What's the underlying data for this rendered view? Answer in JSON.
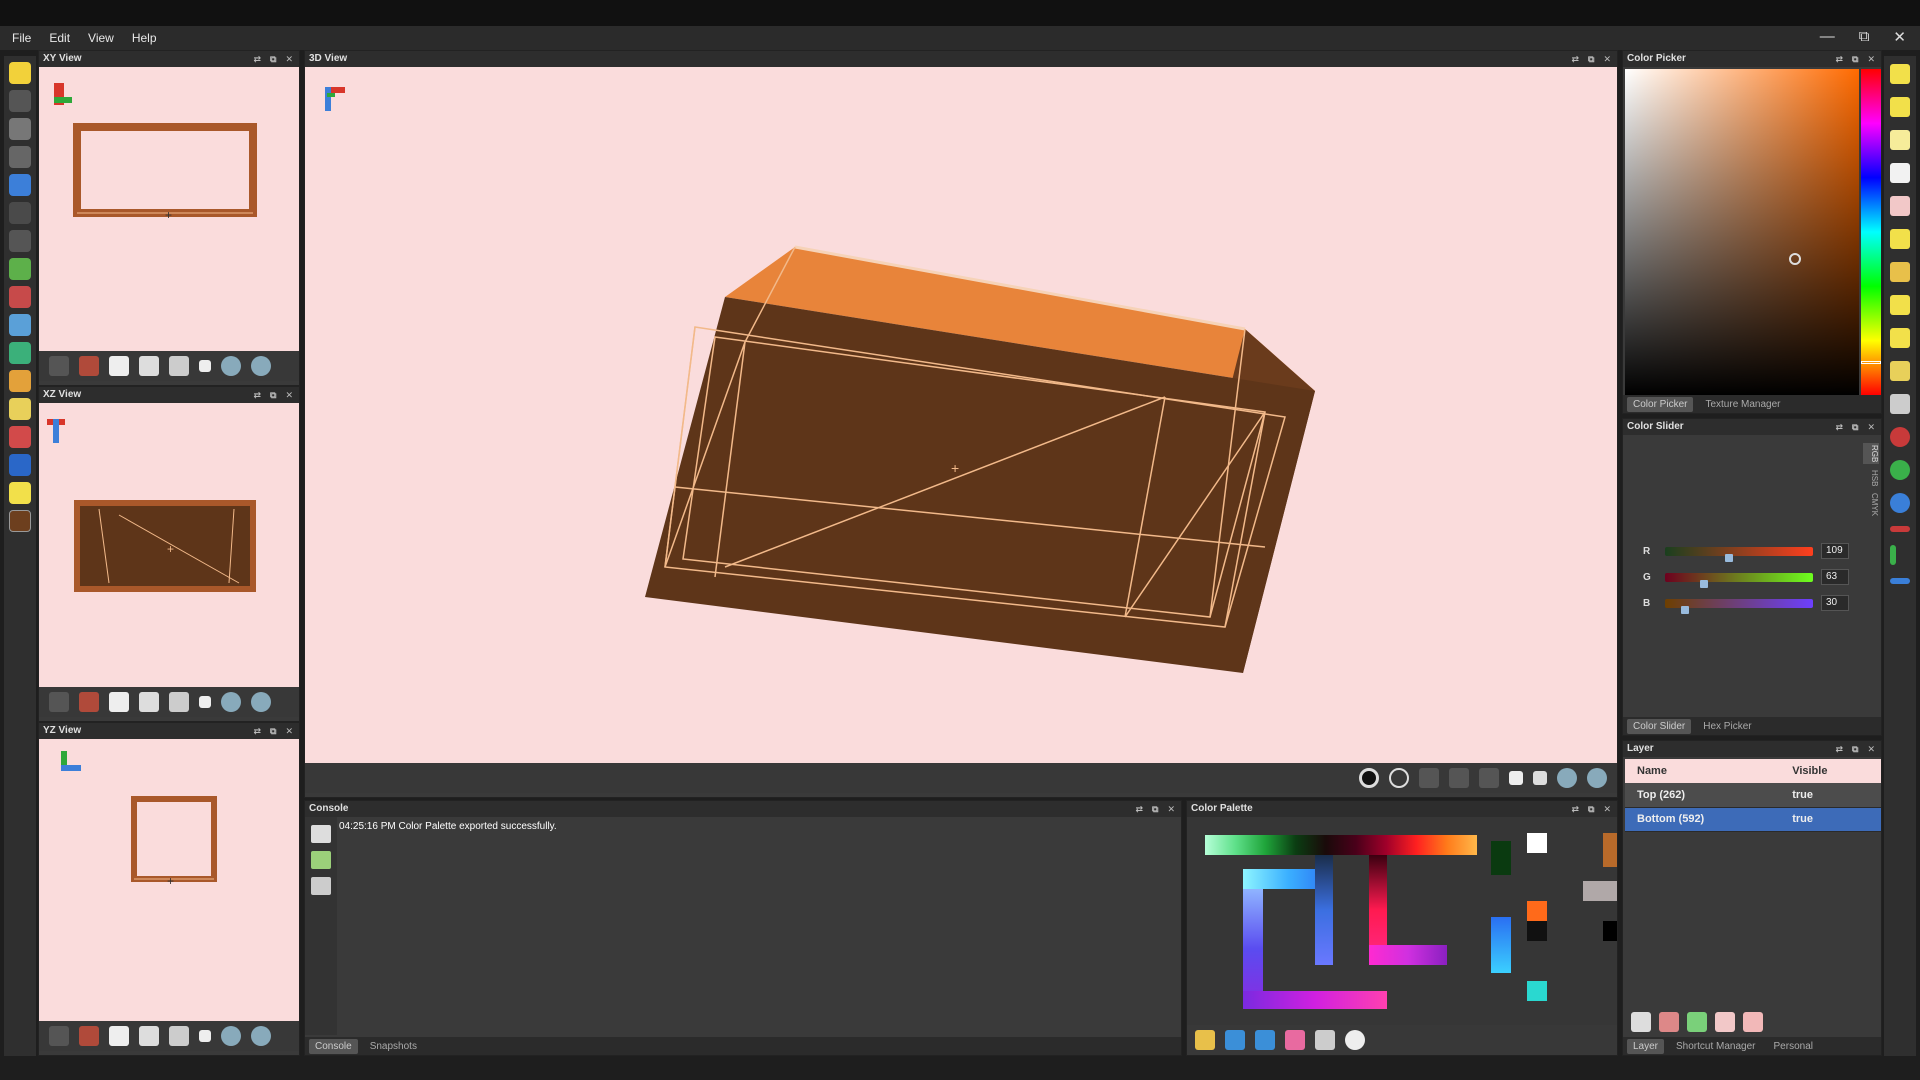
{
  "menu": {
    "file": "File",
    "edit": "Edit",
    "view": "View",
    "help": "Help"
  },
  "window": {
    "minimize": "—",
    "maximize": "⧉",
    "close": "✕"
  },
  "panels": {
    "xy": "XY View",
    "xz": "XZ View",
    "yz": "YZ View",
    "view3d": "3D View",
    "color_picker": "Color Picker",
    "color_slider": "Color Slider",
    "layer": "Layer",
    "console": "Console",
    "color_palette": "Color Palette"
  },
  "color_picker_tabs": {
    "picker": "Color Picker",
    "texture": "Texture Manager"
  },
  "color_slider": {
    "modes": [
      "RGB",
      "HSB",
      "CMYK"
    ],
    "r_label": "R",
    "r_value": "109",
    "g_label": "G",
    "g_value": "63",
    "b_label": "B",
    "b_value": "30",
    "r": 109,
    "g": 63,
    "b": 30
  },
  "color_slider_tabs": {
    "slider": "Color Slider",
    "hex": "Hex Picker"
  },
  "layer": {
    "col_name": "Name",
    "col_visible": "Visible",
    "rows": [
      {
        "name": "Top (262)",
        "visible": "true"
      },
      {
        "name": "Bottom (592)",
        "visible": "true"
      }
    ]
  },
  "layer_tabs": {
    "layer": "Layer",
    "shortcut": "Shortcut Manager",
    "personal": "Personal"
  },
  "console": {
    "message": "04:25:16 PM Color Palette exported successfully.",
    "tab_console": "Console",
    "tab_snapshots": "Snapshots"
  },
  "colors": {
    "viewport_bg": "#fadcdc",
    "box_front": "#5e3519",
    "box_top": "#e8843a",
    "box_side": "#6a3b1c",
    "wire": "#f2b98a",
    "selected_row": "#3d6bb8"
  }
}
